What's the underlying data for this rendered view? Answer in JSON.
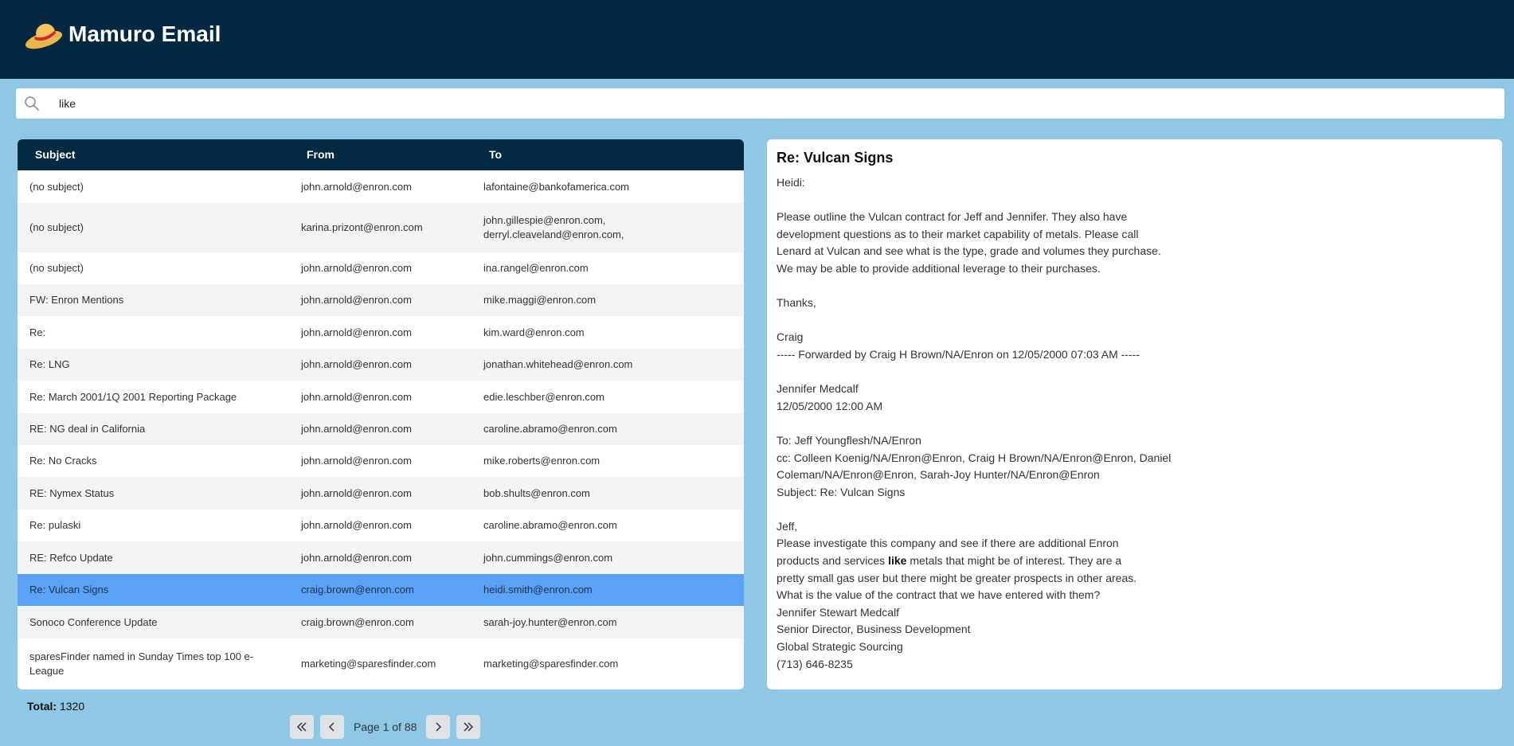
{
  "app": {
    "title": "Mamuro Email"
  },
  "search": {
    "value": "like"
  },
  "table": {
    "headers": {
      "subject": "Subject",
      "from": "From",
      "to": "To"
    },
    "rows": [
      {
        "subject": "(no subject)",
        "from": "john.arnold@enron.com",
        "to": "lafontaine@bankofamerica.com",
        "selected": false
      },
      {
        "subject": "(no subject)",
        "from": "karina.prizont@enron.com",
        "to": "john.gillespie@enron.com,\nderryl.cleaveland@enron.com,",
        "selected": false
      },
      {
        "subject": "(no subject)",
        "from": "john.arnold@enron.com",
        "to": "ina.rangel@enron.com",
        "selected": false
      },
      {
        "subject": "FW: Enron Mentions",
        "from": "john.arnold@enron.com",
        "to": "mike.maggi@enron.com",
        "selected": false
      },
      {
        "subject": "Re:",
        "from": "john.arnold@enron.com",
        "to": "kim.ward@enron.com",
        "selected": false
      },
      {
        "subject": "Re: LNG",
        "from": "john.arnold@enron.com",
        "to": "jonathan.whitehead@enron.com",
        "selected": false
      },
      {
        "subject": "Re: March 2001/1Q 2001 Reporting Package",
        "from": "john.arnold@enron.com",
        "to": "edie.leschber@enron.com",
        "selected": false
      },
      {
        "subject": "RE: NG deal in California",
        "from": "john.arnold@enron.com",
        "to": "caroline.abramo@enron.com",
        "selected": false
      },
      {
        "subject": "Re: No Cracks",
        "from": "john.arnold@enron.com",
        "to": "mike.roberts@enron.com",
        "selected": false
      },
      {
        "subject": "RE: Nymex Status",
        "from": "john.arnold@enron.com",
        "to": "bob.shults@enron.com",
        "selected": false
      },
      {
        "subject": "Re: pulaski",
        "from": "john.arnold@enron.com",
        "to": "caroline.abramo@enron.com",
        "selected": false
      },
      {
        "subject": "RE: Refco Update",
        "from": "john.arnold@enron.com",
        "to": "john.cummings@enron.com",
        "selected": false
      },
      {
        "subject": "Re: Vulcan Signs",
        "from": "craig.brown@enron.com",
        "to": "heidi.smith@enron.com",
        "selected": true
      },
      {
        "subject": "Sonoco Conference Update",
        "from": "craig.brown@enron.com",
        "to": "sarah-joy.hunter@enron.com",
        "selected": false
      },
      {
        "subject": "sparesFinder named in Sunday Times top 100 e-\nLeague",
        "from": "marketing@sparesfinder.com",
        "to": "marketing@sparesfinder.com",
        "selected": false
      }
    ]
  },
  "footer": {
    "total_label": "Total:",
    "total_value": "1320",
    "page_label": "Page 1 of 88"
  },
  "email": {
    "subject": "Re: Vulcan Signs",
    "body_before_highlight": "Heidi:\n\nPlease outline the Vulcan contract for Jeff and Jennifer. They also have\ndevelopment questions as to their market capability of metals. Please call\nLenard at Vulcan and see what is the type, grade and volumes they purchase.\nWe may be able to provide additional leverage to their purchases.\n\nThanks,\n\nCraig\n----- Forwarded by Craig H Brown/NA/Enron on 12/05/2000 07:03 AM -----\n\nJennifer Medcalf\n12/05/2000 12:00 AM\n\nTo: Jeff Youngflesh/NA/Enron\ncc: Colleen Koenig/NA/Enron@Enron, Craig H Brown/NA/Enron@Enron, Daniel\nColeman/NA/Enron@Enron, Sarah-Joy Hunter/NA/Enron@Enron\nSubject: Re: Vulcan Signs\n\nJeff,\nPlease investigate this company and see if there are additional Enron\nproducts and services ",
    "highlight": "like",
    "body_after_highlight": " metals that might be of interest. They are a\npretty small gas user but there might be greater prospects in other areas.\nWhat is the value of the contract that we have entered with them?\nJennifer Stewart Medcalf\nSenior Director, Business Development\nGlobal Strategic Sourcing\n(713) 646-8235"
  }
}
